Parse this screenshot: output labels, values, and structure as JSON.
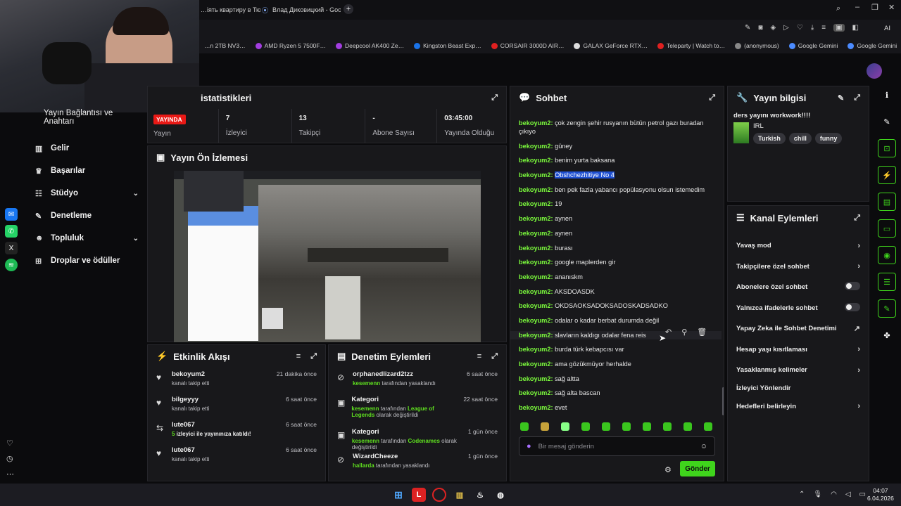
{
  "browser": {
    "tabs": [
      {
        "label": "…іять квартиру в Тюмени"
      },
      {
        "label": "Влад Диковицкий - Goog"
      }
    ],
    "new_tab": "+",
    "ai_label": "AI",
    "bookmarks": [
      "…n 2TB NV3…",
      "AMD Ryzen 5 7500F…",
      "Deepcool AK400 Ze…",
      "Kingston Beast Exp…",
      "CORSAIR 3000D AIR…",
      "GALAX GeForce RTX…",
      "Teleparty | Watch to…",
      "(anonymous)",
      "Google Gemini",
      "Google Gemini"
    ]
  },
  "nav": {
    "title": "Yayın Bağlantısı ve Anahtarı",
    "items": [
      {
        "label": "Gelir",
        "icon": "bank-icon"
      },
      {
        "label": "Başarılar",
        "icon": "trophy-icon"
      },
      {
        "label": "Stüdyo",
        "icon": "sliders-icon",
        "chev": "⌄"
      },
      {
        "label": "Denetleme",
        "icon": "wrench-icon"
      },
      {
        "label": "Topluluk",
        "icon": "people-icon",
        "chev": "⌄"
      },
      {
        "label": "Droplar ve ödüller",
        "icon": "gift-icon"
      }
    ]
  },
  "stats": {
    "title": "istatistikleri",
    "live": "YAYINDA",
    "live_label": "Yayın",
    "items": [
      {
        "v": "7",
        "l": "İzleyici"
      },
      {
        "v": "13",
        "l": "Takipçi"
      },
      {
        "v": "-",
        "l": "Abone Sayısı"
      },
      {
        "v": "03:45:00",
        "l": "Yayında Olduğu"
      }
    ]
  },
  "preview": {
    "title": "Yayın Ön İzlemesi"
  },
  "activity": {
    "title": "Etkinlik Akışı",
    "items": [
      {
        "t1": "bekoyum2",
        "t2": "kanalı takip etti",
        "tm": "21 dakika önce",
        "icon": "heart-icon"
      },
      {
        "t1": "bilgeyyy",
        "t2": "kanalı takip etti",
        "tm": "6 saat önce",
        "icon": "heart-icon"
      },
      {
        "t1": "lute067",
        "t2a": "5",
        "t2b": " izleyici ile yayınınıza katıldı!",
        "tm": "6 saat önce",
        "icon": "raid-icon"
      },
      {
        "t1": "lute067",
        "t2": "kanalı takip etti",
        "tm": "6 saat önce",
        "icon": "heart-icon"
      }
    ]
  },
  "moderation": {
    "title": "Denetim Eylemleri",
    "items": [
      {
        "t1": "orphanedlizard2tzz",
        "u": "kesemenn",
        "rest": " tarafından yasaklandı",
        "tm": "6 saat önce"
      },
      {
        "t1": "Kategori",
        "u": "kesemenn",
        "rest": " tarafından ",
        "g2": "League of Legends",
        "rest2": " olarak değiştirildi",
        "tm": "22 saat önce"
      },
      {
        "t1": "Kategori",
        "u": "kesemenn",
        "rest": " tarafından ",
        "g2": "Codenames",
        "rest2": " olarak değiştirildi",
        "tm": "1 gün önce"
      },
      {
        "t1": "WizardCheeze",
        "u": "hallarda",
        "rest": " tarafından yasaklandı",
        "tm": "1 gün önce"
      }
    ]
  },
  "chat": {
    "title": "Sohbet",
    "messages": [
      {
        "u": "bekoyum2:",
        "m": "çok zengin şehir rusyanın bütün petrol gazı buradan çıkıyo"
      },
      {
        "u": "bekoyum2:",
        "m": "güney"
      },
      {
        "u": "bekoyum2:",
        "m": "benim yurta baksana"
      },
      {
        "u": "bekoyum2:",
        "m": "Obshchezhitiye No 4",
        "hl": true
      },
      {
        "u": "bekoyum2:",
        "m": "ben pek fazla yabancı popülasyonu olsun istemedim"
      },
      {
        "u": "bekoyum2:",
        "m": "19"
      },
      {
        "u": "bekoyum2:",
        "m": "aynen"
      },
      {
        "u": "bekoyum2:",
        "m": "aynen"
      },
      {
        "u": "bekoyum2:",
        "m": "burası"
      },
      {
        "u": "bekoyum2:",
        "m": "google maplerden gir"
      },
      {
        "u": "bekoyum2:",
        "m": "ananıskm"
      },
      {
        "u": "bekoyum2:",
        "m": "AKSDOASDK"
      },
      {
        "u": "bekoyum2:",
        "m": "OKDSAOKSADOKSADOSKADSADKO"
      },
      {
        "u": "bekoyum2:",
        "m": "odalar o kadar berbat durumda değil"
      },
      {
        "u": "bekoyum2:",
        "m": "slavların kaldıgı odalar fena reis"
      },
      {
        "u": "bekoyum2:",
        "m": "burda türk kebapcısı var"
      },
      {
        "u": "bekoyum2:",
        "m": "ama gözükmüyor herhalde"
      },
      {
        "u": "bekoyum2:",
        "m": "sağ altta"
      },
      {
        "u": "bekoyum2:",
        "m": "sağ alta bascan"
      },
      {
        "u": "bekoyum2:",
        "m": "evet"
      }
    ],
    "placeholder": "Bir mesaj gönderin",
    "send": "Gönder"
  },
  "info": {
    "title": "Yayın bilgisi",
    "stream_title": "ders yayını workwork!!!!",
    "category": "IRL",
    "tags": [
      "Turkish",
      "chill",
      "funny"
    ]
  },
  "actions": {
    "title": "Kanal Eylemleri",
    "items": [
      {
        "label": "Yavaş mod",
        "r": "›"
      },
      {
        "label": "Takipçilere özel sohbet",
        "r": "›"
      },
      {
        "label": "Abonelere özel sohbet",
        "toggle": true
      },
      {
        "label": "Yalnızca ifadelerle sohbet",
        "toggle": true
      },
      {
        "label": "Yapay Zeka ile Sohbet Denetimi",
        "r": "↗"
      },
      {
        "label": "Hesap yaşı kısıtlaması",
        "r": "›"
      },
      {
        "label": "Yasaklanmış kelimeler",
        "r": "›"
      },
      {
        "label": "İzleyici Yönlendir",
        "r": ""
      },
      {
        "label": "Hedefleri belirleyin",
        "r": "›"
      }
    ]
  },
  "taskbar": {
    "time": "04:07",
    "date": "6.04.2026"
  }
}
